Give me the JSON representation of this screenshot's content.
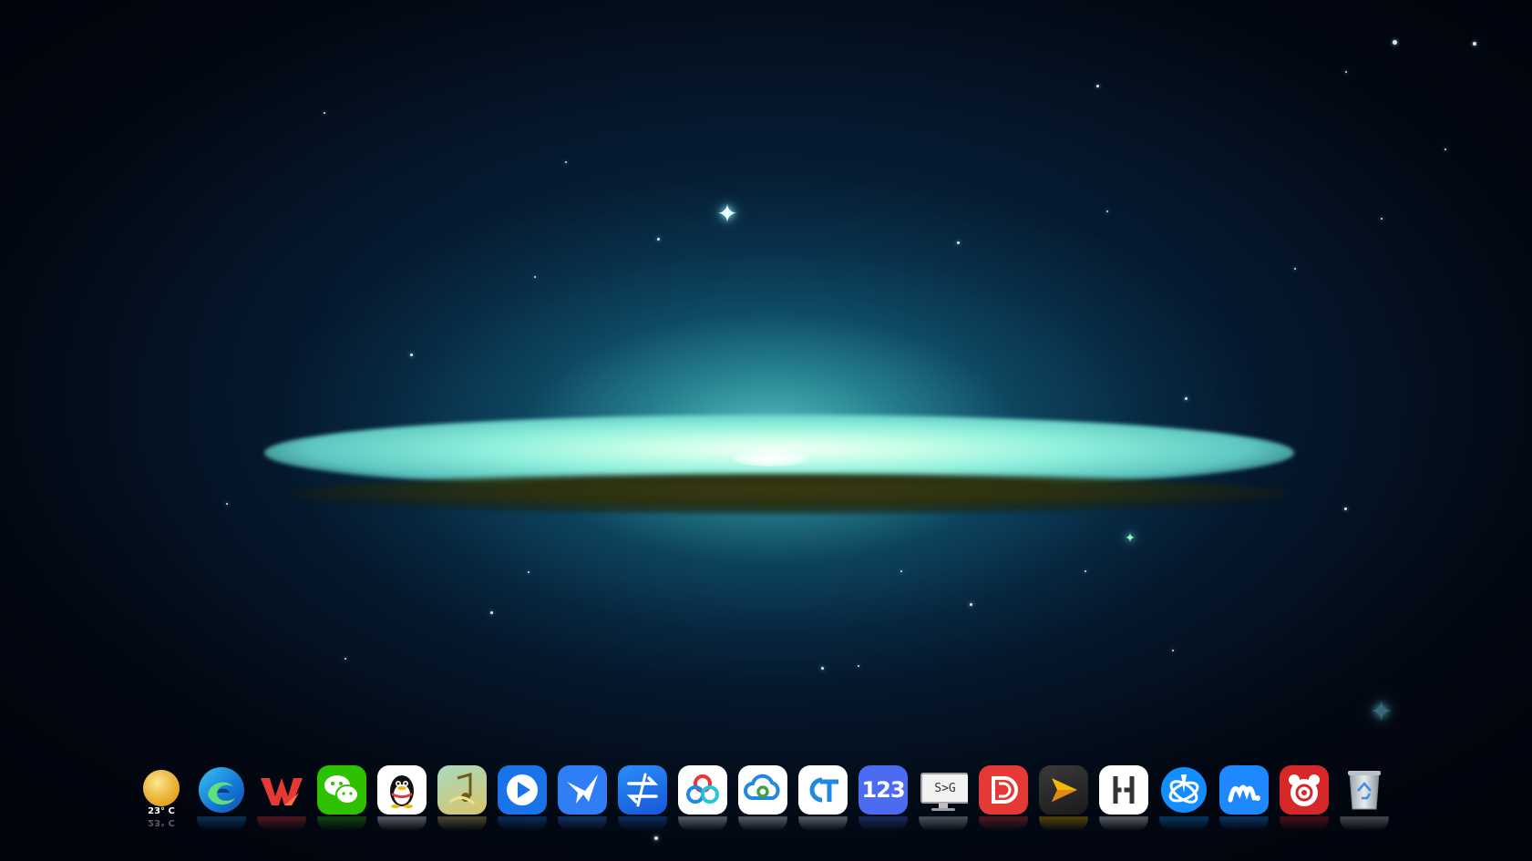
{
  "wallpaper": {
    "description_colors": {
      "space": "#01040d",
      "glow": "#5dc6c0",
      "core": "#f4fff8",
      "dust_lane": "#2a3010"
    }
  },
  "dock": {
    "items": [
      {
        "name": "weather",
        "icon": "sun-icon",
        "label": "23° C",
        "color": "#f6c23e"
      },
      {
        "name": "edge",
        "icon": "edge-browser-icon",
        "color": "#1e88e5"
      },
      {
        "name": "wps",
        "icon": "wps-office-icon",
        "color": "#e53935"
      },
      {
        "name": "wechat",
        "icon": "wechat-icon",
        "color": "#2dc100"
      },
      {
        "name": "qq",
        "icon": "qq-penguin-icon",
        "color": "#ffffff"
      },
      {
        "name": "music-player",
        "icon": "music-note-icon",
        "color": "#d7c56a"
      },
      {
        "name": "video-player",
        "icon": "play-circle-icon",
        "color": "#1a73e8"
      },
      {
        "name": "feishu-transfer",
        "icon": "paper-plane-bird-icon",
        "color": "#2f7ef6"
      },
      {
        "name": "file-transfer",
        "icon": "transfer-arrows-icon",
        "color": "#1e6ff0"
      },
      {
        "name": "baidu-netdisk",
        "icon": "baidu-netdisk-icon",
        "color": "#ffffff"
      },
      {
        "name": "cloud-drive",
        "icon": "cloud-icon",
        "color": "#ffffff"
      },
      {
        "name": "ct-app",
        "icon": "ct-logo-icon",
        "color": "#ffffff"
      },
      {
        "name": "123-pan",
        "icon": "123-icon",
        "label": "123",
        "color": "#4b6cf2"
      },
      {
        "name": "remote-desktop",
        "icon": "monitor-icon",
        "label": "S>G",
        "color": "#e0e0e0"
      },
      {
        "name": "red-app",
        "icon": "red-d-icon",
        "color": "#e53935"
      },
      {
        "name": "potplayer",
        "icon": "potplayer-icon",
        "color": "#2b2b2b"
      },
      {
        "name": "h-app",
        "icon": "h-logo-icon",
        "color": "#ffffff"
      },
      {
        "name": "battlenet",
        "icon": "battlenet-icon",
        "color": "#148eff"
      },
      {
        "name": "m-app",
        "icon": "m-logo-icon",
        "color": "#1e88ff"
      },
      {
        "name": "bear-app",
        "icon": "bear-face-icon",
        "color": "#d62828"
      },
      {
        "name": "recycle-bin",
        "icon": "recycle-bin-icon",
        "color": "#bfc7cf"
      }
    ]
  }
}
